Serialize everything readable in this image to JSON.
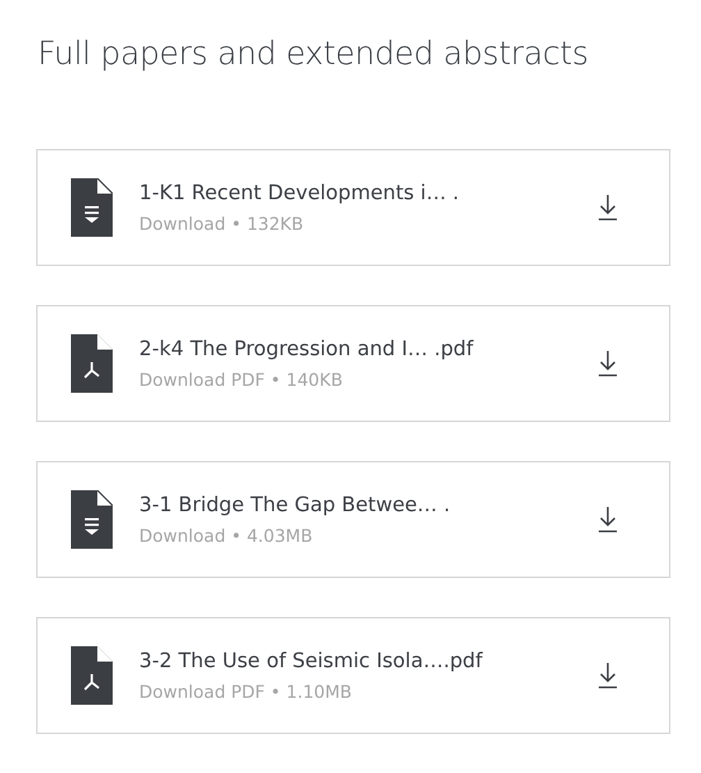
{
  "heading": "Full papers and extended abstracts",
  "files": [
    {
      "kind": "doc",
      "name": "1-K1 Recent Developments i… .",
      "meta": "Download • 132KB"
    },
    {
      "kind": "pdf",
      "name": "2-k4 The Progression and I…  .pdf",
      "meta": "Download PDF • 140KB"
    },
    {
      "kind": "doc",
      "name": "3-1 Bridge The Gap Betwee…  .",
      "meta": "Download • 4.03MB"
    },
    {
      "kind": "pdf",
      "name": "3-2 The Use of Seismic Isola….pdf",
      "meta": "Download PDF • 1.10MB"
    }
  ]
}
